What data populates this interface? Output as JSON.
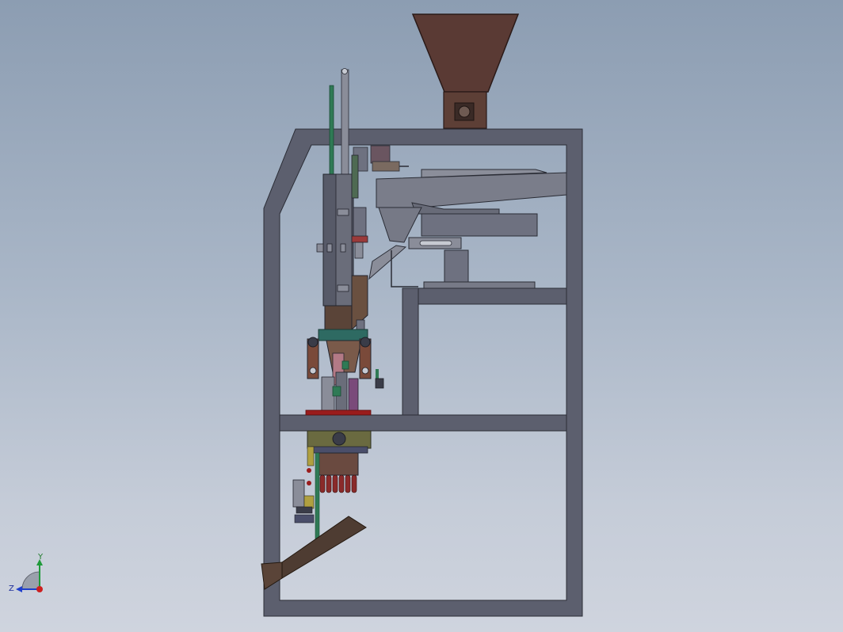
{
  "viewport": {
    "background_top": "#8c9db2",
    "background_bottom": "#cfd4de"
  },
  "colors": {
    "frame": "#5c5f6e",
    "hopper": "#5a3a34",
    "mechanism_gray": "#6e7180",
    "steel_blue": "#5a6a8a",
    "green_accent": "#2f7a55",
    "red_plate": "#9a1c1c",
    "chute": "#4e3c32",
    "pink_part": "#b37a86"
  },
  "triad": {
    "y_label": "Y",
    "z_label": "Z",
    "x_color": "#cc1f1f",
    "y_color": "#1f9a3a",
    "z_color": "#1f3fcc"
  }
}
